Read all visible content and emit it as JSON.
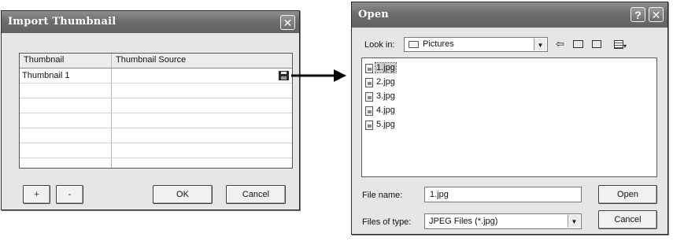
{
  "import_dialog": {
    "title": "Import Thumbnail",
    "close_glyph": "✕",
    "columns": [
      "Thumbnail",
      "Thumbnail Source"
    ],
    "rows": [
      {
        "thumbnail": "Thumbnail 1",
        "source": ""
      },
      {
        "thumbnail": "",
        "source": ""
      },
      {
        "thumbnail": "",
        "source": ""
      },
      {
        "thumbnail": "",
        "source": ""
      },
      {
        "thumbnail": "",
        "source": ""
      },
      {
        "thumbnail": "",
        "source": ""
      },
      {
        "thumbnail": "",
        "source": ""
      }
    ],
    "browse_icon": "floppy-disk-icon",
    "add_label": "+",
    "remove_label": "-",
    "ok_label": "OK",
    "cancel_label": "Cancel"
  },
  "arrow": {
    "icon": "right-arrow-icon"
  },
  "open_dialog": {
    "title": "Open",
    "help_glyph": "?",
    "close_glyph": "✕",
    "look_in_label": "Look in:",
    "look_in_value": "Pictures",
    "toolbar_icons": [
      "back-arrow-icon",
      "up-folder-icon",
      "new-folder-icon",
      "view-menu-icon"
    ],
    "files": [
      "1.jpg",
      "2.jpg",
      "3.jpg",
      "4.jpg",
      "5.jpg"
    ],
    "selected_file": "1.jpg",
    "file_name_label": "File name:",
    "file_name_value": "1.jpg",
    "files_of_type_label": "Files of type:",
    "files_of_type_value": "JPEG Files (*.jpg)",
    "open_label": "Open",
    "cancel_label": "Cancel"
  }
}
